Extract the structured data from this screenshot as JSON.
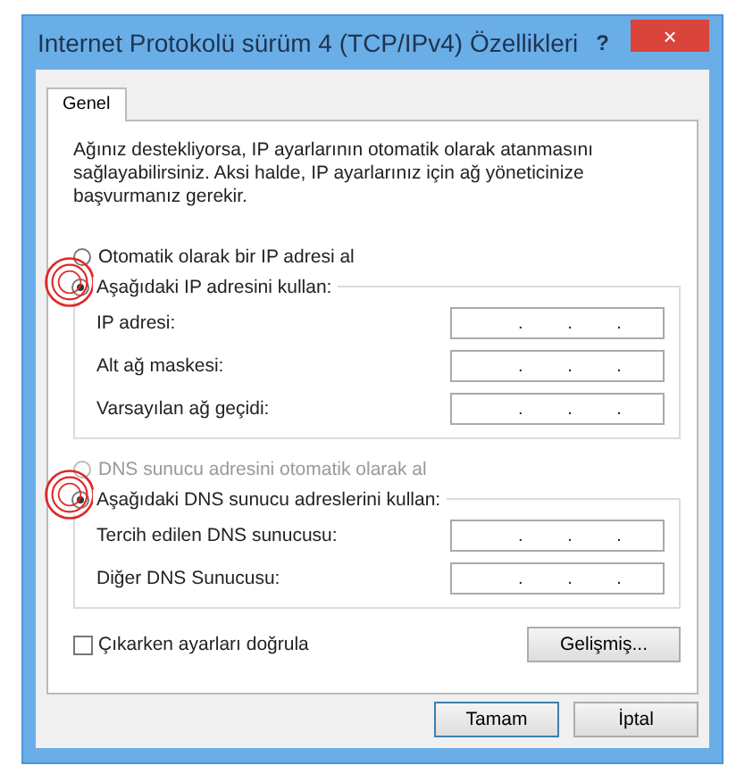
{
  "window": {
    "title": "Internet Protokolü sürüm 4 (TCP/IPv4) Özellikleri",
    "help": "?",
    "close": "×"
  },
  "tabs": [
    {
      "label": "Genel",
      "selected": true
    }
  ],
  "description": "Ağınız destekliyorsa, IP ayarlarının otomatik olarak atanmasını sağlayabilirsiniz. Aksi halde, IP ayarlarınız için ağ yöneticinize başvurmanız gerekir.",
  "ip_options": [
    {
      "label": "Otomatik olarak bir IP adresi al",
      "selected": false,
      "disabled": false,
      "highlighted": false
    },
    {
      "label": "Aşağıdaki IP adresini kullan:",
      "selected": true,
      "disabled": false,
      "highlighted": true
    }
  ],
  "ip_fields": [
    {
      "label": "IP adresi:",
      "value": ". . ."
    },
    {
      "label": "Alt ağ maskesi:",
      "value": ". . ."
    },
    {
      "label": "Varsayılan ağ geçidi:",
      "value": ". . ."
    }
  ],
  "dns_options": [
    {
      "label": "DNS sunucu adresini otomatik olarak al",
      "selected": false,
      "disabled": true,
      "highlighted": false
    },
    {
      "label": "Aşağıdaki DNS sunucu adreslerini kullan:",
      "selected": true,
      "disabled": false,
      "highlighted": true
    }
  ],
  "dns_fields": [
    {
      "label": "Tercih edilen DNS sunucusu:",
      "value": ". . ."
    },
    {
      "label": "Diğer DNS Sunucusu:",
      "value": ". . ."
    }
  ],
  "validate_checkbox": {
    "label": "Çıkarken ayarları doğrula",
    "checked": false
  },
  "advanced_button": "Gelişmiş...",
  "buttons": [
    {
      "label": "Tamam",
      "kind": "default"
    },
    {
      "label": "İptal",
      "kind": "normal"
    }
  ]
}
